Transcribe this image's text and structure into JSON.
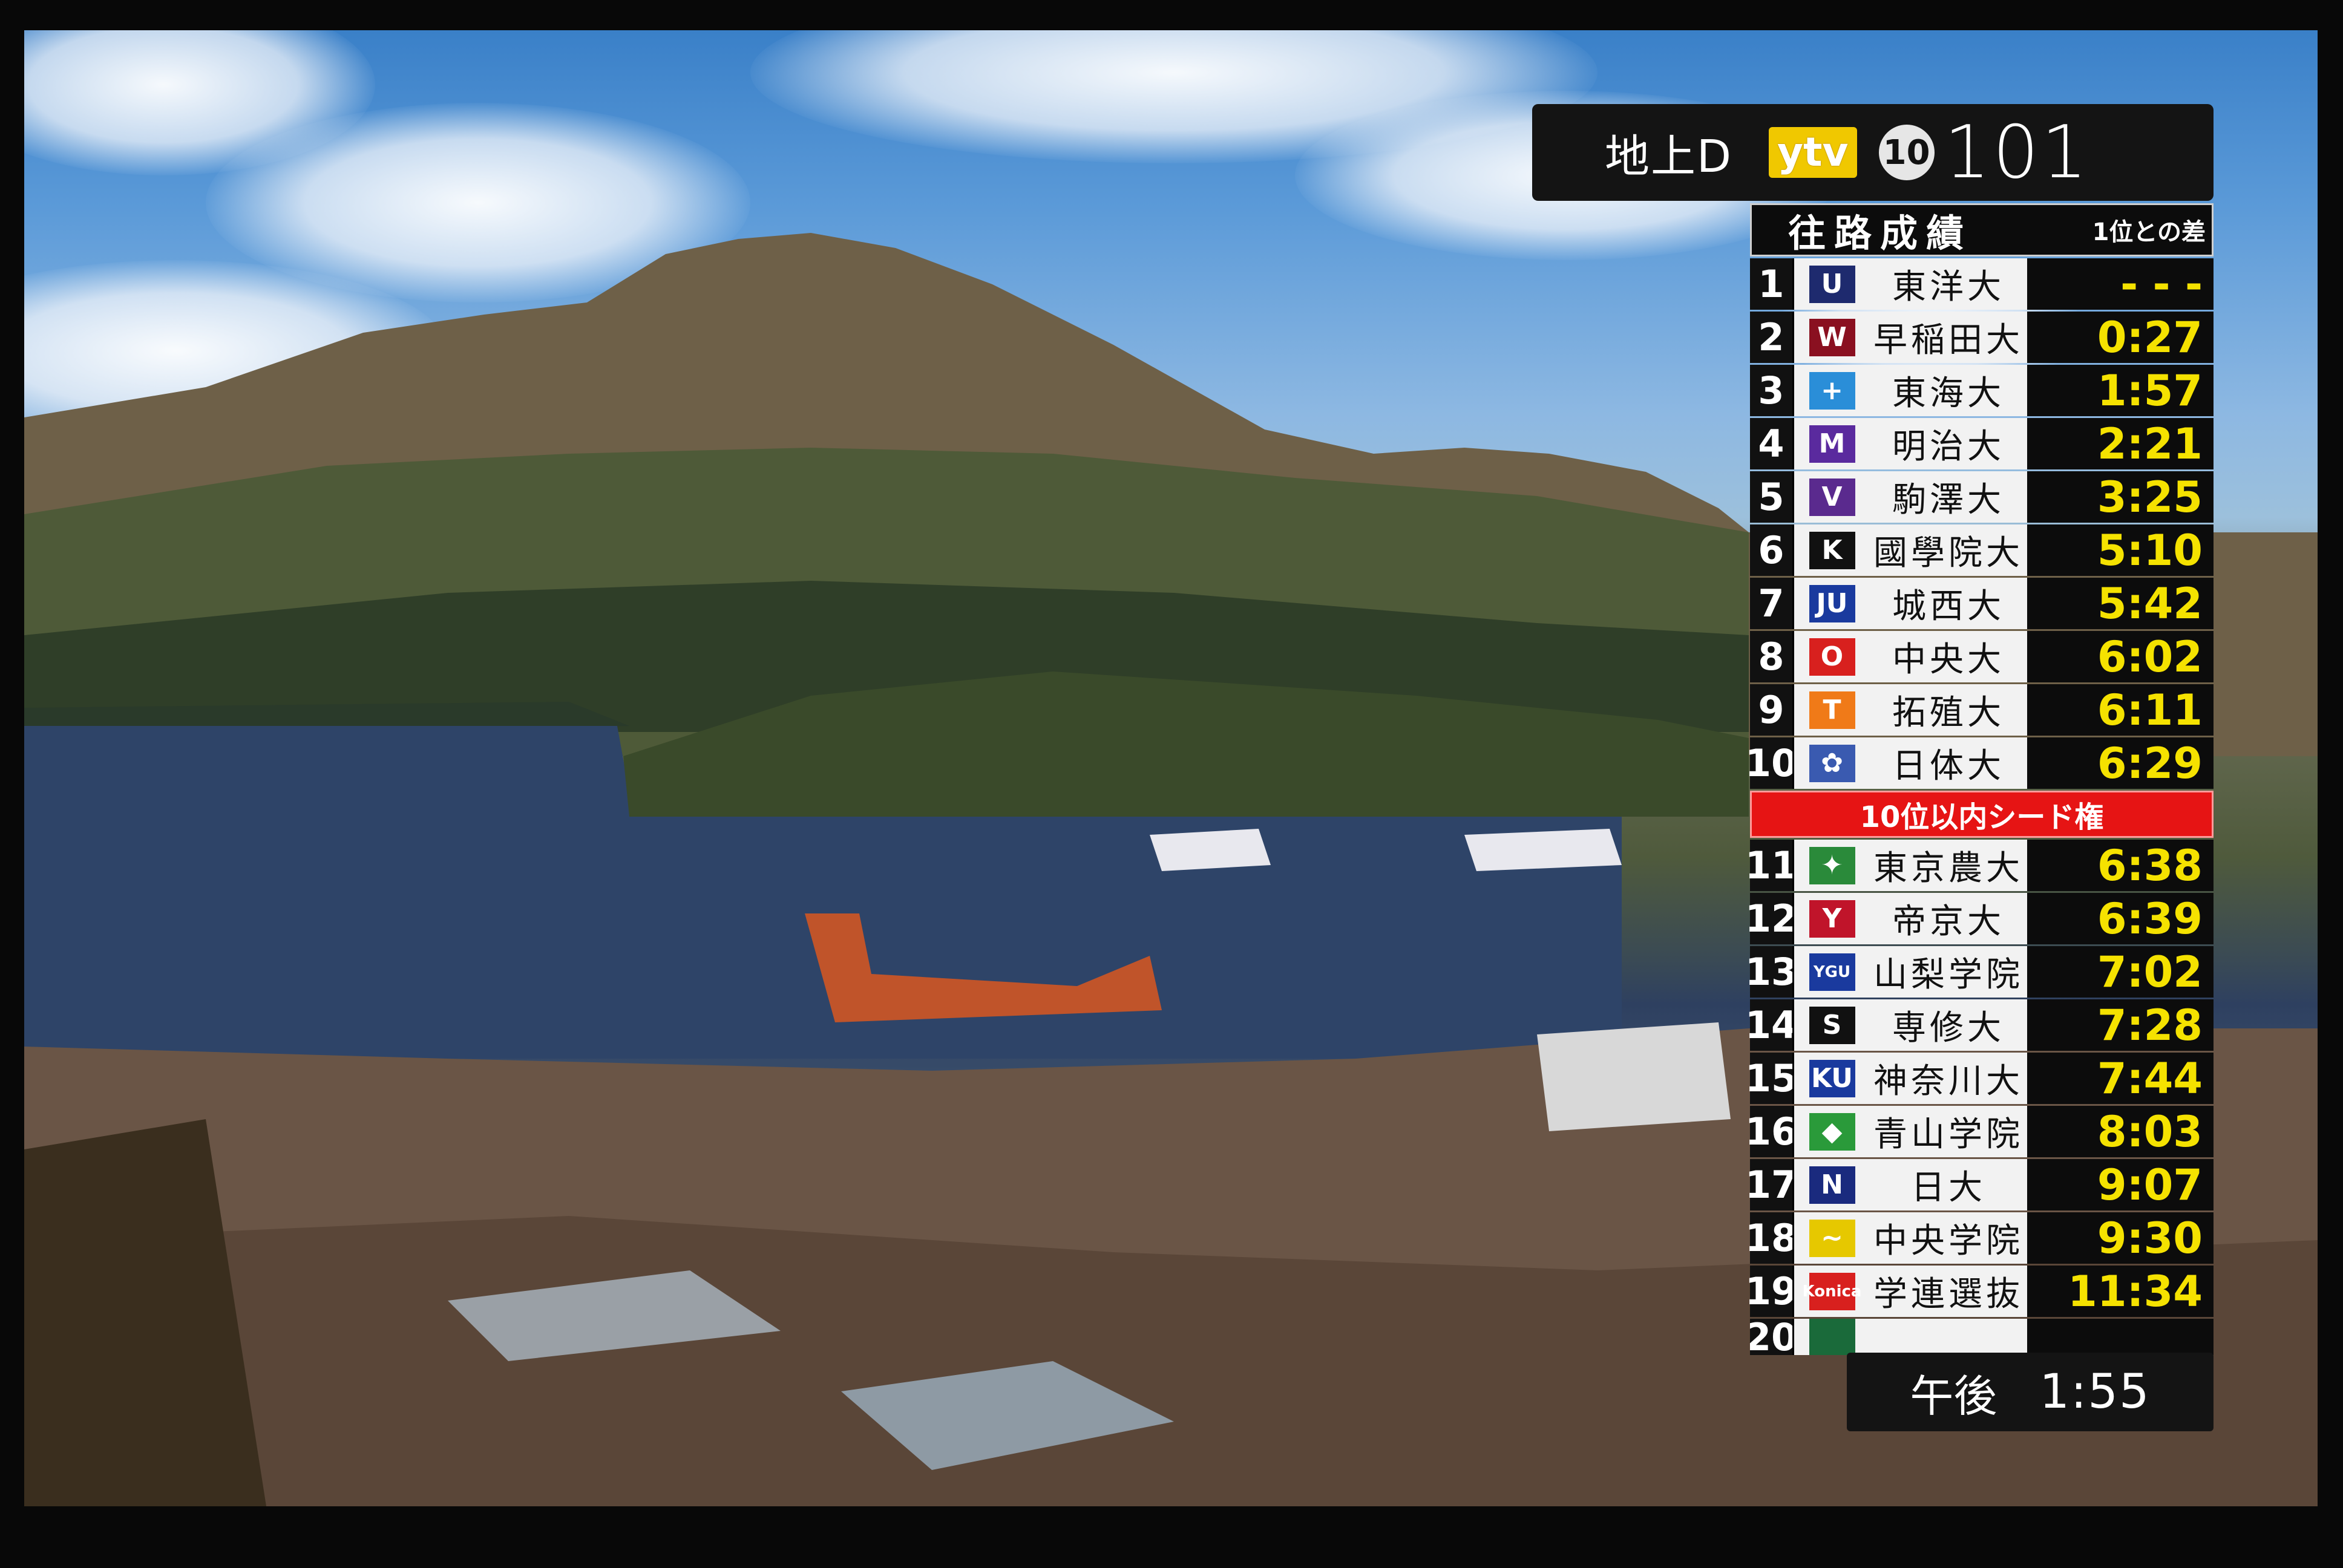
{
  "osd": {
    "source": "地上D",
    "station_logo": "ytv",
    "remote_key": "10",
    "channel": "101"
  },
  "standings": {
    "title": "往路成績",
    "subtitle": "1位との差",
    "seed_label": "10位以内シード権",
    "rows": [
      {
        "rank": "1",
        "emblem": "U",
        "emblem_color": "#1e2a6e",
        "school": "東洋大",
        "diff": "- - -"
      },
      {
        "rank": "2",
        "emblem": "W",
        "emblem_color": "#8a1020",
        "school": "早稲田大",
        "diff": "0:27"
      },
      {
        "rank": "3",
        "emblem": "+",
        "emblem_color": "#2a8ed8",
        "school": "東海大",
        "diff": "1:57"
      },
      {
        "rank": "4",
        "emblem": "M",
        "emblem_color": "#5a2a9e",
        "school": "明治大",
        "diff": "2:21"
      },
      {
        "rank": "5",
        "emblem": "V",
        "emblem_color": "#5a2a8e",
        "school": "駒澤大",
        "diff": "3:25"
      },
      {
        "rank": "6",
        "emblem": "K",
        "emblem_color": "#111111",
        "school": "國學院大",
        "diff": "5:10"
      },
      {
        "rank": "7",
        "emblem": "JU",
        "emblem_color": "#1a3a9e",
        "school": "城西大",
        "diff": "5:42"
      },
      {
        "rank": "8",
        "emblem": "O",
        "emblem_color": "#d8201e",
        "school": "中央大",
        "diff": "6:02"
      },
      {
        "rank": "9",
        "emblem": "T",
        "emblem_color": "#f07a18",
        "school": "拓殖大",
        "diff": "6:11"
      },
      {
        "rank": "10",
        "emblem": "✿",
        "emblem_color": "#3a5ab0",
        "school": "日体大",
        "diff": "6:29"
      },
      {
        "rank": "11",
        "emblem": "✦",
        "emblem_color": "#2a8a3a",
        "school": "東京農大",
        "diff": "6:38"
      },
      {
        "rank": "12",
        "emblem": "Y",
        "emblem_color": "#c0142a",
        "school": "帝京大",
        "diff": "6:39"
      },
      {
        "rank": "13",
        "emblem": "YGU",
        "emblem_color": "#1a3a9e",
        "school": "山梨学院",
        "diff": "7:02"
      },
      {
        "rank": "14",
        "emblem": "S",
        "emblem_color": "#111111",
        "school": "専修大",
        "diff": "7:28"
      },
      {
        "rank": "15",
        "emblem": "KU",
        "emblem_color": "#1a3a9e",
        "school": "神奈川大",
        "diff": "7:44"
      },
      {
        "rank": "16",
        "emblem": "◆",
        "emblem_color": "#2a9a3a",
        "school": "青山学院",
        "diff": "8:03"
      },
      {
        "rank": "17",
        "emblem": "N",
        "emblem_color": "#1a2a7e",
        "school": "日大",
        "diff": "9:07"
      },
      {
        "rank": "18",
        "emblem": "~",
        "emblem_color": "#e6c800",
        "school": "中央学院",
        "diff": "9:30"
      },
      {
        "rank": "19",
        "emblem": "Konica",
        "emblem_color": "#d8201e",
        "school": "学連選抜",
        "diff": "11:34"
      },
      {
        "rank": "20",
        "emblem": "",
        "emblem_color": "#1a6a3a",
        "school": "",
        "diff": ""
      }
    ]
  },
  "clock": {
    "ampm": "午後",
    "time": "1:55"
  }
}
